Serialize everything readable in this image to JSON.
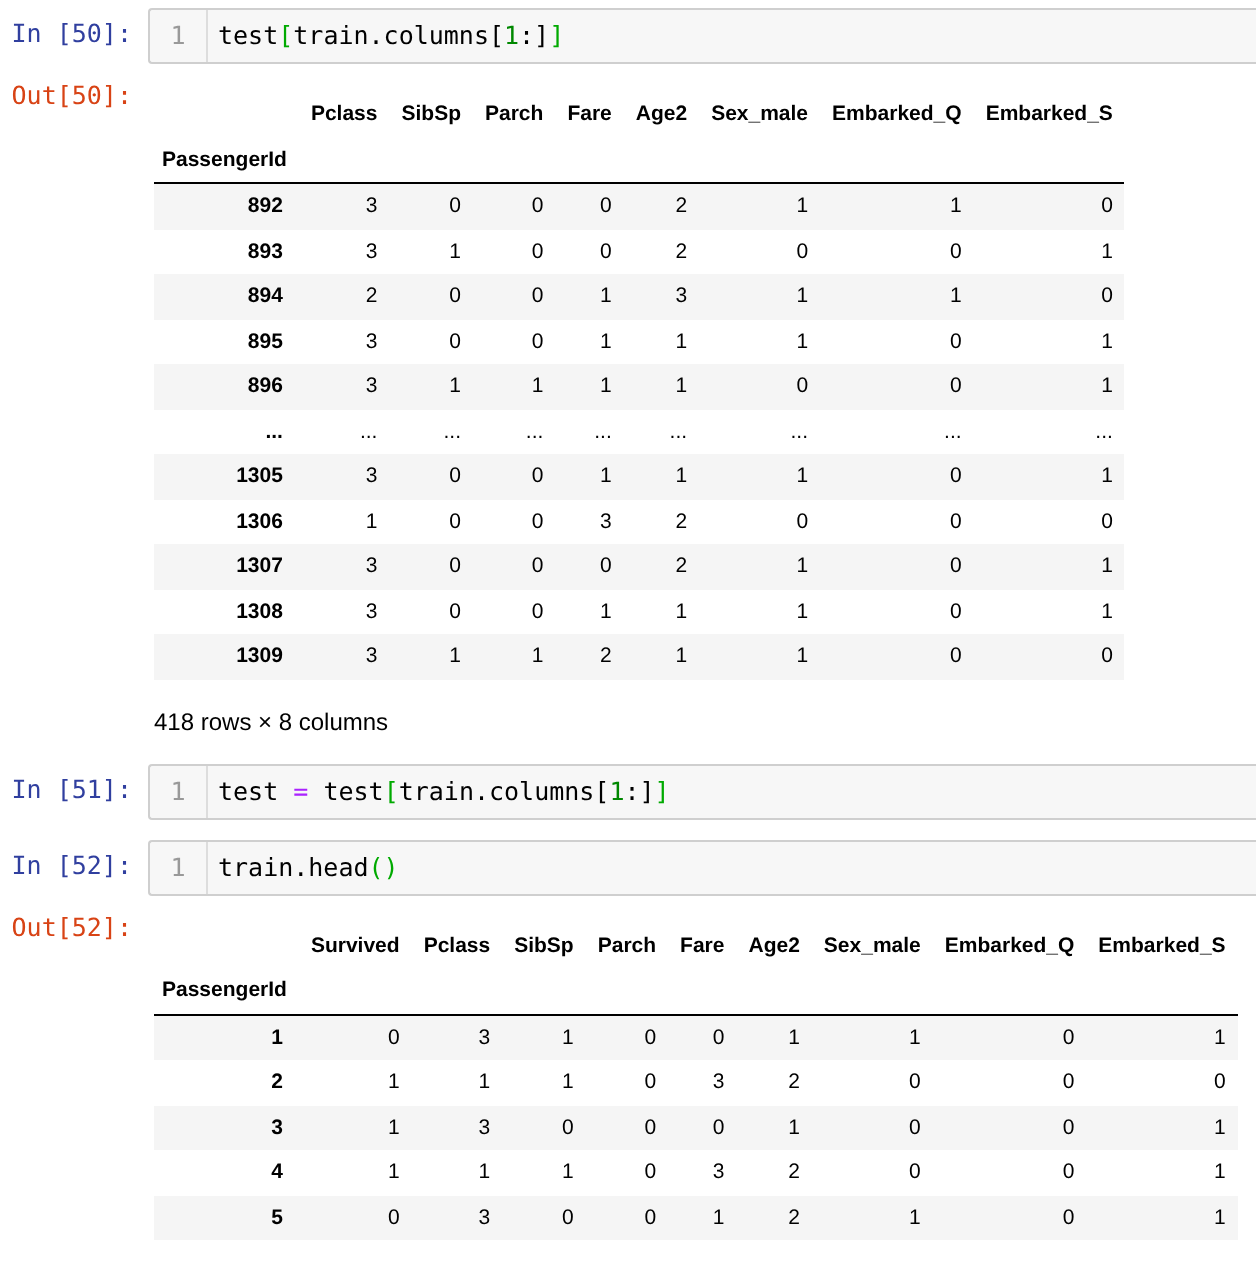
{
  "cells": [
    {
      "prompt": "In [50]:",
      "line_number": "1",
      "tokens": [
        {
          "text": "test",
          "kind": "plain"
        },
        {
          "text": "[",
          "kind": "bracket"
        },
        {
          "text": "train.columns[",
          "kind": "plain"
        },
        {
          "text": "1",
          "kind": "number"
        },
        {
          "text": ":]",
          "kind": "plain"
        },
        {
          "text": "]",
          "kind": "bracket"
        }
      ],
      "output": {
        "prompt": "Out[50]:",
        "columns": [
          "Pclass",
          "SibSp",
          "Parch",
          "Fare",
          "Age2",
          "Sex_male",
          "Embarked_Q",
          "Embarked_S"
        ],
        "index_name": "PassengerId",
        "rows": [
          {
            "index": "892",
            "values": [
              "3",
              "0",
              "0",
              "0",
              "2",
              "1",
              "1",
              "0"
            ]
          },
          {
            "index": "893",
            "values": [
              "3",
              "1",
              "0",
              "0",
              "2",
              "0",
              "0",
              "1"
            ]
          },
          {
            "index": "894",
            "values": [
              "2",
              "0",
              "0",
              "1",
              "3",
              "1",
              "1",
              "0"
            ]
          },
          {
            "index": "895",
            "values": [
              "3",
              "0",
              "0",
              "1",
              "1",
              "1",
              "0",
              "1"
            ]
          },
          {
            "index": "896",
            "values": [
              "3",
              "1",
              "1",
              "1",
              "1",
              "0",
              "0",
              "1"
            ]
          },
          {
            "index": "...",
            "values": [
              "...",
              "...",
              "...",
              "...",
              "...",
              "...",
              "...",
              "..."
            ]
          },
          {
            "index": "1305",
            "values": [
              "3",
              "0",
              "0",
              "1",
              "1",
              "1",
              "0",
              "1"
            ]
          },
          {
            "index": "1306",
            "values": [
              "1",
              "0",
              "0",
              "3",
              "2",
              "0",
              "0",
              "0"
            ]
          },
          {
            "index": "1307",
            "values": [
              "3",
              "0",
              "0",
              "0",
              "2",
              "1",
              "0",
              "1"
            ]
          },
          {
            "index": "1308",
            "values": [
              "3",
              "0",
              "0",
              "1",
              "1",
              "1",
              "0",
              "1"
            ]
          },
          {
            "index": "1309",
            "values": [
              "3",
              "1",
              "1",
              "2",
              "1",
              "1",
              "0",
              "0"
            ]
          }
        ],
        "footer": "418 rows × 8 columns"
      }
    },
    {
      "prompt": "In [51]:",
      "line_number": "1",
      "tokens": [
        {
          "text": "test ",
          "kind": "plain"
        },
        {
          "text": "=",
          "kind": "operator"
        },
        {
          "text": " test",
          "kind": "plain"
        },
        {
          "text": "[",
          "kind": "bracket"
        },
        {
          "text": "train.columns[",
          "kind": "plain"
        },
        {
          "text": "1",
          "kind": "number"
        },
        {
          "text": ":]",
          "kind": "plain"
        },
        {
          "text": "]",
          "kind": "bracket"
        }
      ]
    },
    {
      "prompt": "In [52]:",
      "line_number": "1",
      "tokens": [
        {
          "text": "train.head",
          "kind": "plain"
        },
        {
          "text": "()",
          "kind": "bracket"
        }
      ],
      "output": {
        "prompt": "Out[52]:",
        "columns": [
          "Survived",
          "Pclass",
          "SibSp",
          "Parch",
          "Fare",
          "Age2",
          "Sex_male",
          "Embarked_Q",
          "Embarked_S"
        ],
        "index_name": "PassengerId",
        "rows": [
          {
            "index": "1",
            "values": [
              "0",
              "3",
              "1",
              "0",
              "0",
              "1",
              "1",
              "0",
              "1"
            ]
          },
          {
            "index": "2",
            "values": [
              "1",
              "1",
              "1",
              "0",
              "3",
              "2",
              "0",
              "0",
              "0"
            ]
          },
          {
            "index": "3",
            "values": [
              "1",
              "3",
              "0",
              "0",
              "0",
              "1",
              "0",
              "0",
              "1"
            ]
          },
          {
            "index": "4",
            "values": [
              "1",
              "1",
              "1",
              "0",
              "3",
              "2",
              "0",
              "0",
              "1"
            ]
          },
          {
            "index": "5",
            "values": [
              "0",
              "3",
              "0",
              "0",
              "1",
              "2",
              "1",
              "0",
              "1"
            ]
          }
        ]
      }
    }
  ]
}
